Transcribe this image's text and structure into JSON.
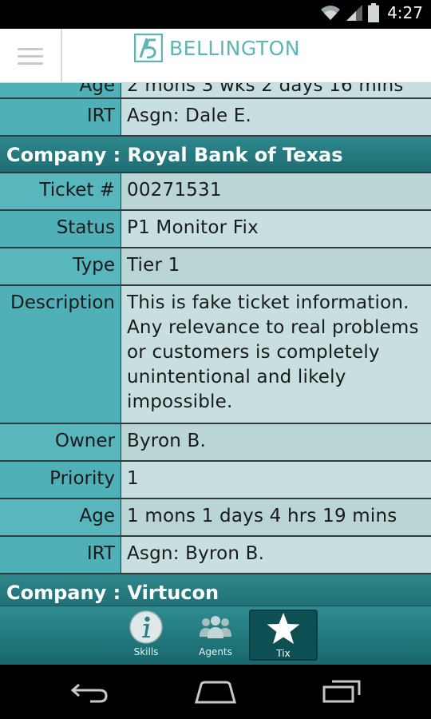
{
  "status_bar": {
    "time": "4:27",
    "icons": [
      "wifi-icon",
      "signal-icon",
      "battery-icon"
    ]
  },
  "header": {
    "brand_name": "BELLINGTON",
    "logo": "bellington-logo",
    "menu_icon": "hamburger-menu-icon",
    "brand_color": "#5db6b3"
  },
  "list": {
    "partial_row": {
      "label": "Age",
      "value": "2 mons 3 wks 2 days 16 mins"
    },
    "first_irt": {
      "label": "IRT",
      "value": "Asgn: Dale E."
    },
    "companies": [
      {
        "header": "Company : Royal Bank of Texas",
        "ticket": {
          "label": "Ticket #",
          "value": "00271531"
        },
        "status": {
          "label": "Status",
          "value": "P1 Monitor Fix"
        },
        "type": {
          "label": "Type",
          "value": "Tier 1"
        },
        "description": {
          "label": "Description",
          "value": "This is fake ticket information. Any relevance to real problems or customers is completely unintentional and likely impossible."
        },
        "owner": {
          "label": "Owner",
          "value": "Byron B."
        },
        "priority": {
          "label": "Priority",
          "value": "1"
        },
        "age": {
          "label": "Age",
          "value": "1 mons 1 days 4 hrs 19 mins"
        },
        "irt": {
          "label": "IRT",
          "value": "Asgn: Byron B."
        }
      },
      {
        "header": "Company : Virtucon"
      }
    ]
  },
  "tabs": [
    {
      "label": "Skills",
      "icon": "info-icon",
      "active": false
    },
    {
      "label": "Agents",
      "icon": "people-icon",
      "active": false
    },
    {
      "label": "Tix",
      "icon": "star-icon",
      "active": true
    }
  ],
  "nav_bar": {
    "buttons": [
      "back-icon",
      "home-icon",
      "recent-apps-icon"
    ]
  }
}
